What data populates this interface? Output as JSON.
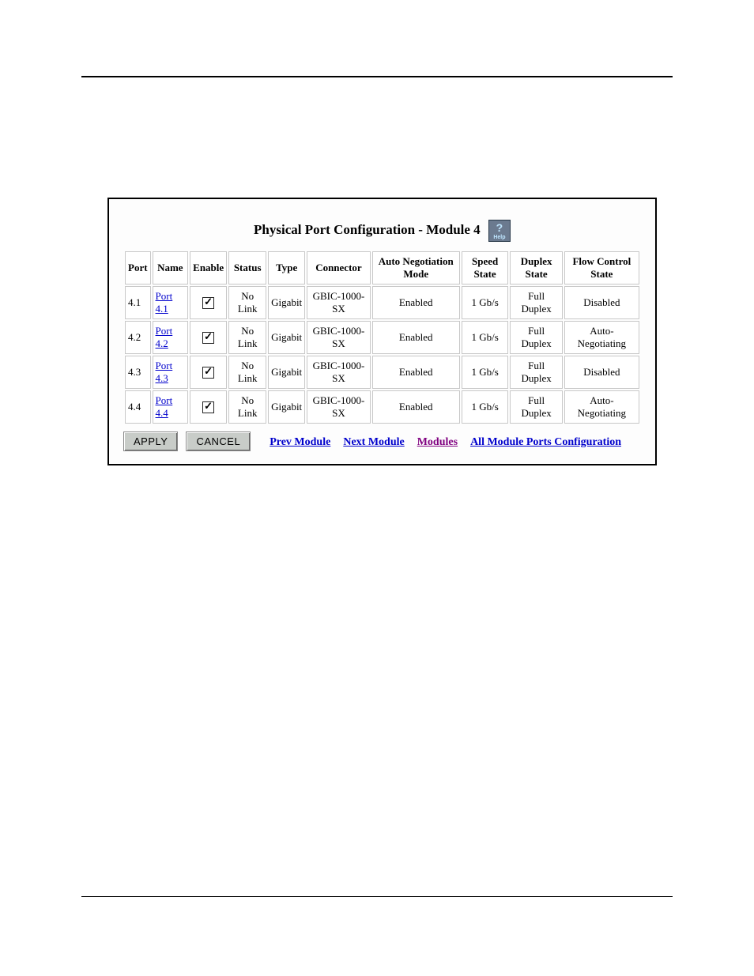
{
  "meta": {
    "running_head_right": "",
    "footer_left": "",
    "footer_right": ""
  },
  "figure": {
    "label": "",
    "caption": ""
  },
  "panel": {
    "title": "Physical Port Configuration - Module 4",
    "help_label": "Help"
  },
  "table": {
    "headers": [
      "Port",
      "Name",
      "Enable",
      "Status",
      "Type",
      "Connector",
      "Auto Negotiation Mode",
      "Speed State",
      "Duplex State",
      "Flow Control State"
    ],
    "rows": [
      {
        "port": "4.1",
        "name": "Port 4.1",
        "enable": true,
        "status": "No Link",
        "type": "Gigabit",
        "connector": "GBIC-1000-SX",
        "auto_neg": "Enabled",
        "speed": "1 Gb/s",
        "duplex": "Full Duplex",
        "flow": "Disabled"
      },
      {
        "port": "4.2",
        "name": "Port 4.2",
        "enable": true,
        "status": "No Link",
        "type": "Gigabit",
        "connector": "GBIC-1000-SX",
        "auto_neg": "Enabled",
        "speed": "1 Gb/s",
        "duplex": "Full Duplex",
        "flow": "Auto-Negotiating"
      },
      {
        "port": "4.3",
        "name": "Port 4.3",
        "enable": true,
        "status": "No Link",
        "type": "Gigabit",
        "connector": "GBIC-1000-SX",
        "auto_neg": "Enabled",
        "speed": "1 Gb/s",
        "duplex": "Full Duplex",
        "flow": "Disabled"
      },
      {
        "port": "4.4",
        "name": "Port 4.4",
        "enable": true,
        "status": "No Link",
        "type": "Gigabit",
        "connector": "GBIC-1000-SX",
        "auto_neg": "Enabled",
        "speed": "1 Gb/s",
        "duplex": "Full Duplex",
        "flow": "Auto-Negotiating"
      }
    ]
  },
  "actions": {
    "apply": "APPLY",
    "cancel": "CANCEL",
    "prev": "Prev Module",
    "next": "Next Module",
    "modules": "Modules",
    "all_ports": "All Module Ports Configuration"
  }
}
